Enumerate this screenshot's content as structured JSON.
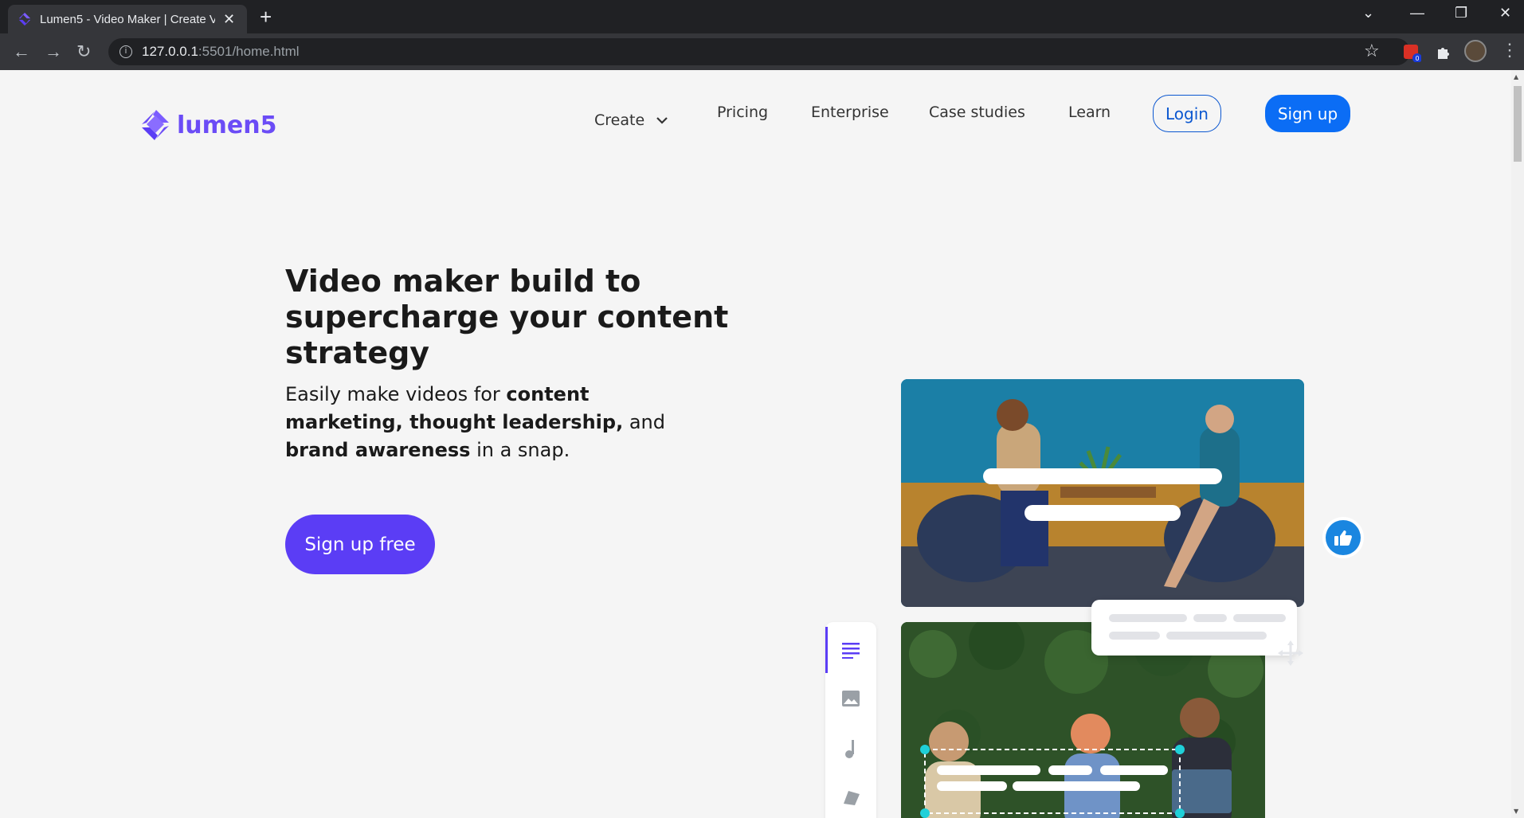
{
  "browser": {
    "tab_title": "Lumen5 - Video Maker | Create V",
    "url_host": "127.0.0.1",
    "url_path": ":5501/home.html",
    "extension_badge": "0"
  },
  "site": {
    "logo_text": "lumen5",
    "brand_color": "#6b4cf6",
    "nav": {
      "create": "Create",
      "pricing": "Pricing",
      "enterprise": "Enterprise",
      "case_studies": "Case studies",
      "learn": "Learn"
    },
    "login_label": "Login",
    "signup_label": "Sign up"
  },
  "hero": {
    "title": "Video maker build to supercharge your content strategy",
    "sub_1": "Easily make videos for ",
    "sub_b1": "content marketing, thought leadership,",
    "sub_2": " and ",
    "sub_b2": "brand awareness",
    "sub_3": " in a snap.",
    "cta_label": "Sign up free",
    "cta_color": "#5b3df5"
  }
}
